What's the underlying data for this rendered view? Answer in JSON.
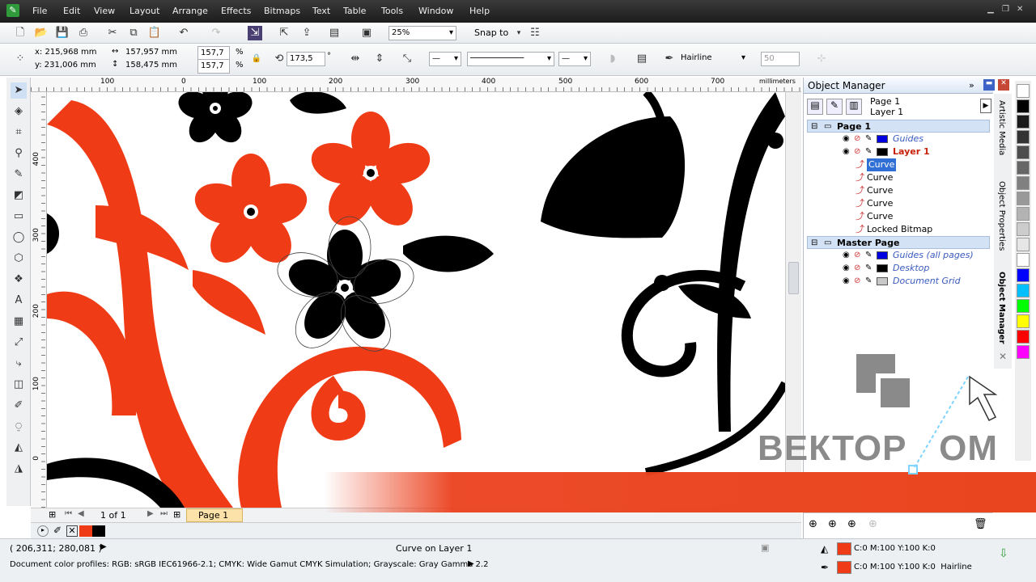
{
  "app": {
    "menu": [
      "File",
      "Edit",
      "View",
      "Layout",
      "Arrange",
      "Effects",
      "Bitmaps",
      "Text",
      "Table",
      "Tools",
      "Window",
      "Help"
    ]
  },
  "toolbar": {
    "zoom": "25%",
    "snap_label": "Snap to"
  },
  "propbar": {
    "x": "x:  215,968 mm",
    "y": "y:  231,006 mm",
    "w": "157,957 mm",
    "h": "158,475 mm",
    "sx": "157,7",
    "sy": "157,7",
    "pct": "%",
    "rot": "173,5",
    "deg": "°",
    "outline": "Hairline",
    "num": "50"
  },
  "ruler": {
    "unit": "millimeters",
    "top": [
      "100",
      "0",
      "100",
      "200",
      "300",
      "400",
      "500",
      "600",
      "700"
    ],
    "left": [
      "400",
      "300",
      "200",
      "100",
      "0"
    ]
  },
  "page_nav": {
    "counter": "1 of 1",
    "tab": "Page 1"
  },
  "docker": {
    "title": "Object Manager",
    "page_label": "Page 1",
    "layer_label": "Layer 1",
    "rows": [
      {
        "label": "Page 1",
        "kind": "hdr"
      },
      {
        "label": "Guides",
        "kind": "layer",
        "color": "#0000e0"
      },
      {
        "label": "Layer 1",
        "kind": "layer",
        "color": "#000000"
      },
      {
        "label": "Curve",
        "kind": "obj",
        "selected": true
      },
      {
        "label": "Curve",
        "kind": "obj"
      },
      {
        "label": "Curve",
        "kind": "obj"
      },
      {
        "label": "Curve",
        "kind": "obj"
      },
      {
        "label": "Curve",
        "kind": "obj"
      },
      {
        "label": "Locked Bitmap",
        "kind": "obj"
      },
      {
        "label": "Master Page",
        "kind": "hdr"
      },
      {
        "label": "Guides (all pages)",
        "kind": "layer",
        "color": "#0000e0"
      },
      {
        "label": "Desktop",
        "kind": "layer",
        "color": "#000000"
      },
      {
        "label": "Document Grid",
        "kind": "layer",
        "color": "#c8c8c8"
      }
    ]
  },
  "vtabs": [
    "Artistic Media",
    "Object Properties",
    "Object Manager"
  ],
  "palette": [
    "#ffffff",
    "#000000",
    "#1a1a1a",
    "#333333",
    "#4d4d4d",
    "#666666",
    "#808080",
    "#999999",
    "#b3b3b3",
    "#cccccc",
    "#e6e6e6",
    "#ffffff",
    "#0000ff",
    "#00bfff",
    "#00ff00",
    "#ffff00",
    "#ff0000",
    "#ff00ff"
  ],
  "status": {
    "coords": "( 206,311; 280,081 )",
    "object": "Curve on Layer 1",
    "profiles": "Document color profiles: RGB: sRGB IEC61966-2.1; CMYK: Wide Gamut CMYK Simulation; Grayscale: Gray Gamma 2.2",
    "fill": "C:0 M:100 Y:100 K:0",
    "outline": "C:0 M:100 Y:100 K:0  Hairline",
    "fill_color": "#ef3b16"
  },
  "watermark": {
    "text": "ВЕКТОР   ОМ"
  }
}
